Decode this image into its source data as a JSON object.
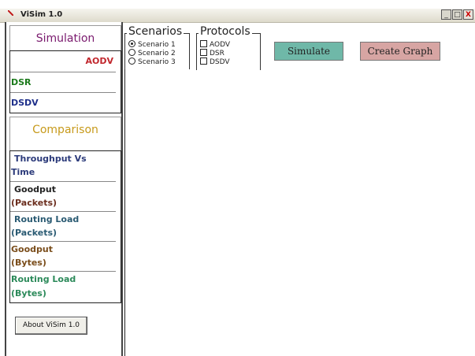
{
  "window": {
    "title": "ViSim 1.0",
    "controls": [
      "_",
      "□",
      "X"
    ]
  },
  "simulation": {
    "heading": "Simulation",
    "items": [
      {
        "label": "AODV",
        "color": "#c1272d"
      },
      {
        "label": "DSR",
        "color": "#1b7a1b"
      },
      {
        "label": "DSDV",
        "color": "#1e2f8a"
      }
    ]
  },
  "comparison": {
    "heading": "Comparison",
    "items": [
      {
        "line1": "Throughput    Vs",
        "line2": "Time",
        "color": "#2b3a7a"
      },
      {
        "line1": "Goodput",
        "line2": "(Packets)",
        "color": "#222222",
        "color2": "#6b2e1e"
      },
      {
        "line1": "Routing Load",
        "line2": "(Packets)",
        "color": "#2b5b73",
        "color2": "#2b5b73"
      },
      {
        "line1": "Goodput",
        "line2": "(Bytes)",
        "color": "#7a4d1b",
        "color2": "#7a4d1b"
      },
      {
        "line1": "Routing Load",
        "line2": "(Bytes)",
        "color": "#2c8a5a",
        "color2": "#2c8a5a"
      }
    ]
  },
  "about_button": "About ViSim 1.0",
  "scenarios": {
    "title": "Scenarios",
    "options": [
      "Scenario 1",
      "Scenario 2",
      "Scenario 3"
    ],
    "selected": "Scenario 1"
  },
  "protocols": {
    "title": "Protocols",
    "options": [
      "AODV",
      "DSR",
      "DSDV"
    ]
  },
  "buttons": {
    "simulate": "Simulate",
    "create_graph": "Create Graph"
  },
  "colors": {
    "simulation_heading": "#7a1a6e",
    "comparison_heading": "#c79a1b",
    "simulate_bg": "#6fb8a8",
    "create_graph_bg": "#d7a5a3"
  }
}
